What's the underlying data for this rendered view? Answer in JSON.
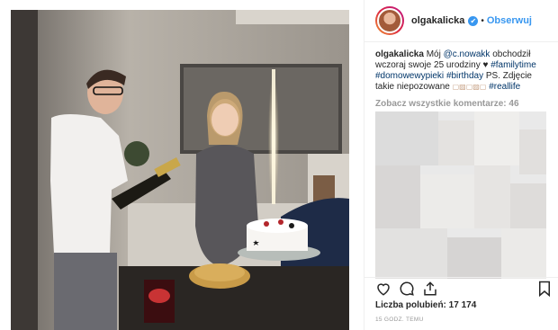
{
  "post": {
    "username": "olgakalicka",
    "verified_mark": "✔",
    "separator": "•",
    "follow_label": "Obserwuj",
    "caption": {
      "user": "olgakalicka",
      "text_1": " Mój ",
      "mention": "@c.nowakk",
      "text_2": " obchodził wczoraj swoje 25 urodziny ♥ ",
      "tag_1": "#familytime",
      "tag_2": "#domowewypieki",
      "tag_3": "#birthday",
      "text_3": " PS. Zdjęcie takie niepozowane ",
      "emoji": "▢▨▢▨▢",
      "tag_4": "#reallife"
    },
    "view_all_comments": "Zobacz wszystkie komentarze: 46",
    "likes": "Liczba polubień: 17 174",
    "timestamp": "15 GODZ. TEMU",
    "icons": [
      "heart-icon",
      "comment-icon",
      "share-icon",
      "bookmark-icon"
    ]
  },
  "colors": {
    "link": "#3897f0",
    "hashtag": "#003569",
    "muted": "#999999"
  }
}
